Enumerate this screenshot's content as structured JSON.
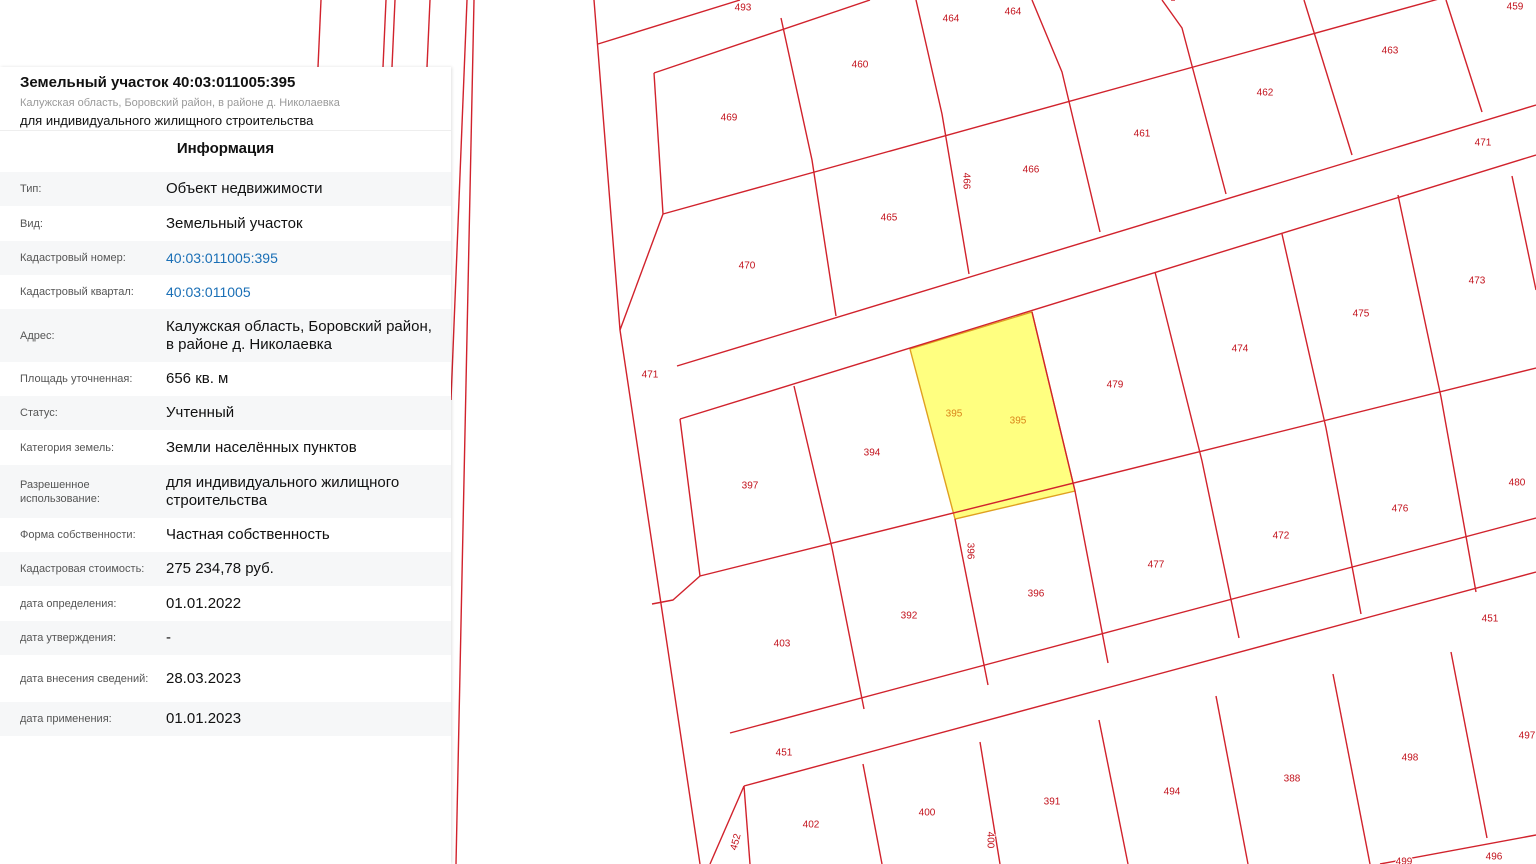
{
  "panel": {
    "title": "Земельный участок 40:03:011005:395",
    "subtitle": "Калужская область, Боровский район, в районе д. Николаевка",
    "usage": "для индивидуального жилищного строительства",
    "section_title": "Информация",
    "rows": [
      {
        "key": "Тип:",
        "value": "Объект недвижимости",
        "link": false
      },
      {
        "key": "Вид:",
        "value": "Земельный участок",
        "link": false
      },
      {
        "key": "Кадастровый номер:",
        "value": "40:03:011005:395",
        "link": true
      },
      {
        "key": "Кадастровый квартал:",
        "value": "40:03:011005",
        "link": true
      },
      {
        "key": "Адрес:",
        "value": "Калужская область, Боровский район, в районе д. Николаевка",
        "link": false
      },
      {
        "key": "Площадь уточненная:",
        "value": "656 кв. м",
        "link": false
      },
      {
        "key": "Статус:",
        "value": "Учтенный",
        "link": false
      },
      {
        "key": "Категория земель:",
        "value": "Земли населённых пунктов",
        "link": false
      },
      {
        "key": "Разрешенное использование:",
        "value": "для индивидуального жилищного строительства",
        "link": false
      },
      {
        "key": "Форма собственности:",
        "value": "Частная собственность",
        "link": false
      },
      {
        "key": "Кадастровая стоимость:",
        "value": "275 234,78 руб.",
        "link": false
      },
      {
        "key": "дата определения:",
        "value": "01.01.2022",
        "link": false
      },
      {
        "key": "дата утверждения:",
        "value": "-",
        "link": false
      },
      {
        "key": "дата внесения сведений:",
        "value": "28.03.2023",
        "link": false
      },
      {
        "key": "дата применения:",
        "value": "01.01.2023",
        "link": false
      }
    ]
  },
  "map": {
    "line_color": "#d1222c",
    "selected_fill": "#ffff80",
    "selected_stroke": "#e0a020",
    "selected_parcel": "395",
    "parcel_labels": [
      "493",
      "464",
      "464",
      "459",
      "460",
      "463",
      "469",
      "462",
      "461",
      "471",
      "466",
      "466",
      "465",
      "470",
      "473",
      "475",
      "474",
      "471",
      "479",
      "395",
      "395",
      "394",
      "397",
      "480",
      "476",
      "472",
      "396",
      "477",
      "396",
      "451",
      "403",
      "392",
      "451",
      "497",
      "498",
      "388",
      "494",
      "391",
      "400",
      "400",
      "402",
      "452",
      "499",
      "496"
    ]
  }
}
